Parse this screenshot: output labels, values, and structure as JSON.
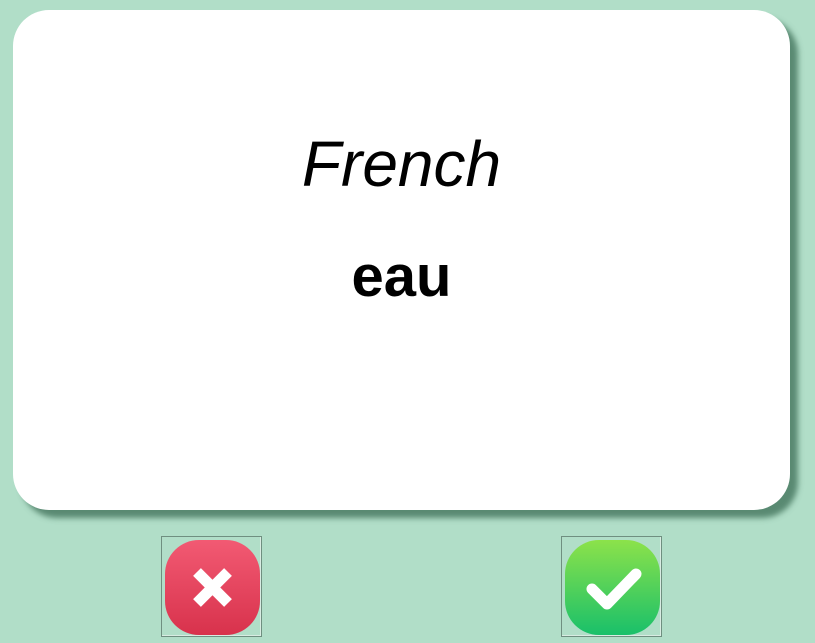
{
  "flashcard": {
    "language": "French",
    "word": "eau"
  },
  "controls": {
    "wrong_icon": "x-mark-icon",
    "right_icon": "check-mark-icon"
  },
  "colors": {
    "background": "#b1dec8",
    "card": "#ffffff",
    "wrong_button": "#e23f5a",
    "right_button": "#3ccc5a"
  }
}
